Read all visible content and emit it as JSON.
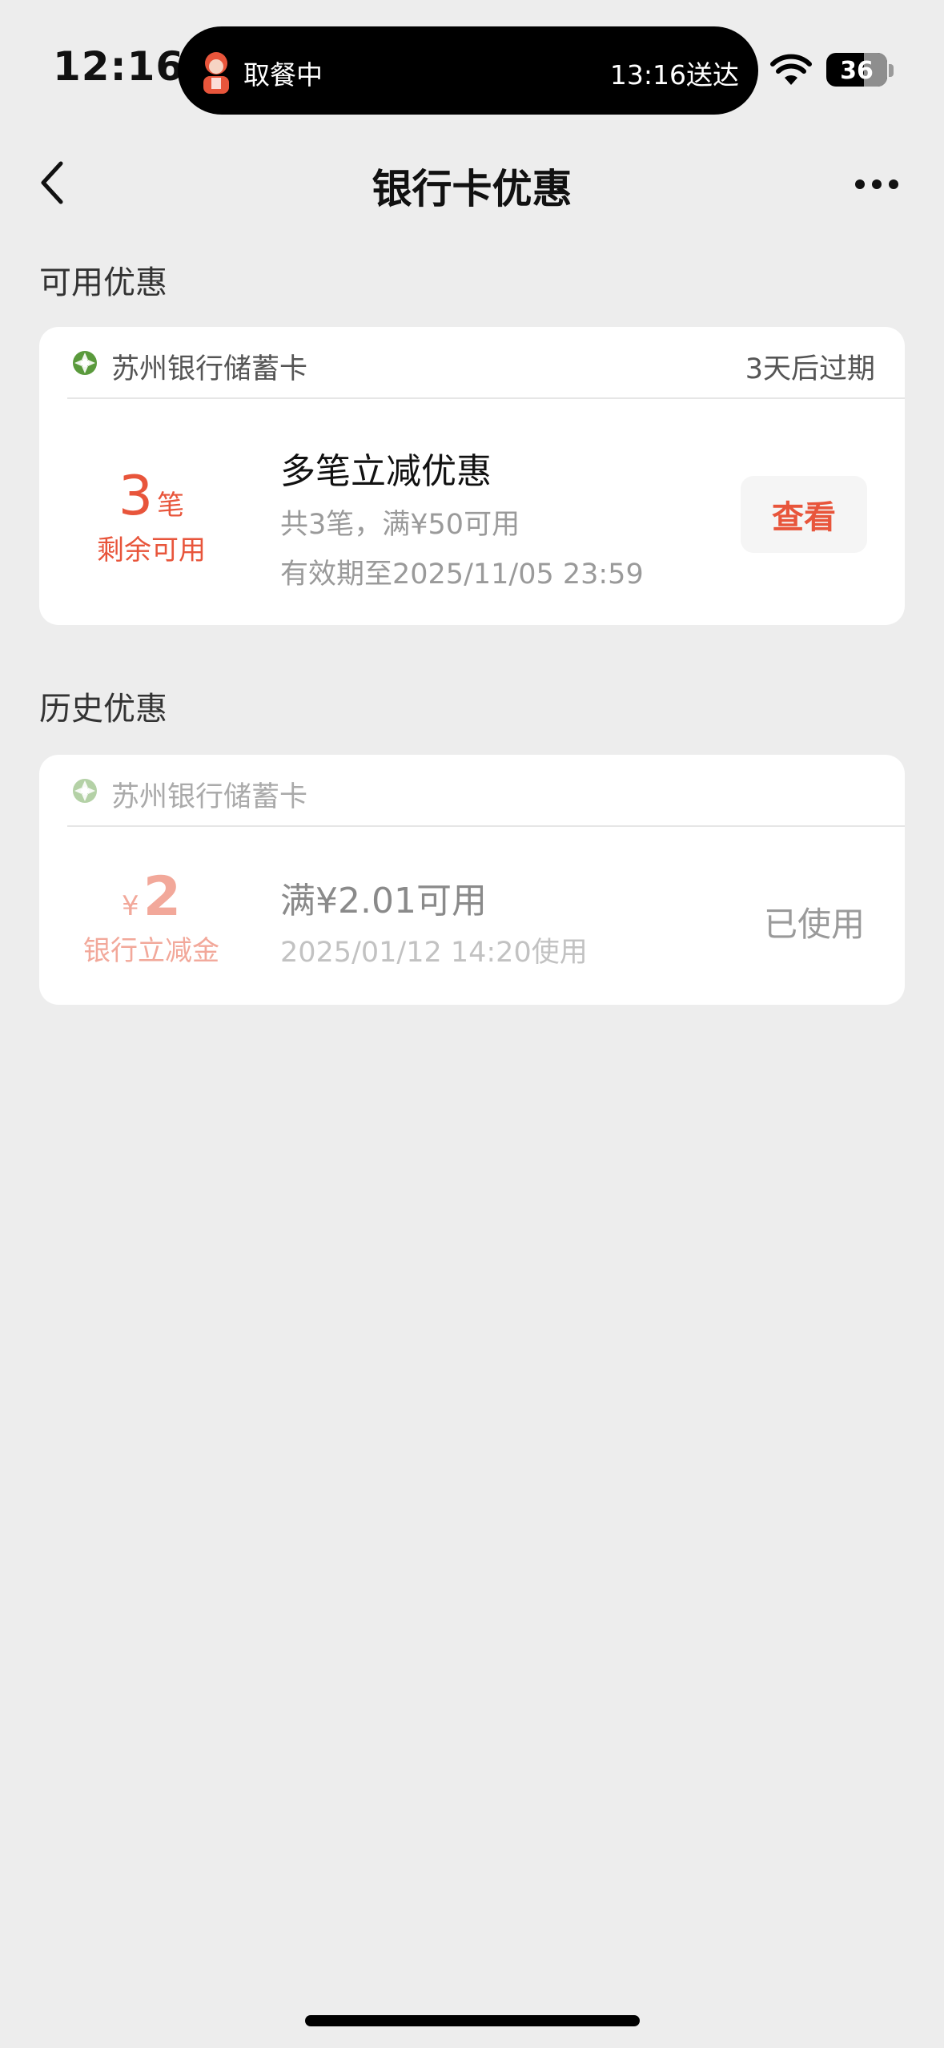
{
  "status_bar": {
    "time": "12:16",
    "live_activity_left": "取餐中",
    "live_activity_right": "13:16送达",
    "battery": "36"
  },
  "nav": {
    "title": "银行卡优惠",
    "back_icon": "chevron-left-icon",
    "more_icon": "ellipsis-icon"
  },
  "available": {
    "section_title": "可用优惠",
    "card": {
      "bank_name": "苏州银行储蓄卡",
      "expire_text": "3天后过期",
      "count_value": "3",
      "count_unit": "笔",
      "count_sub": "剩余可用",
      "title": "多笔立减优惠",
      "desc": "共3笔，满¥50可用",
      "validity": "有效期至2025/11/05 23:59",
      "button_label": "查看"
    }
  },
  "history": {
    "section_title": "历史优惠",
    "card": {
      "bank_name": "苏州银行储蓄卡",
      "amount_symbol": "¥",
      "amount_value": "2",
      "amount_sub": "银行立减金",
      "title": "满¥2.01可用",
      "used_time": "2025/01/12 14:20使用",
      "status": "已使用"
    }
  },
  "colors": {
    "accent": "#e8553b",
    "background": "#ededed",
    "bank_icon": "#5a9a3c"
  }
}
